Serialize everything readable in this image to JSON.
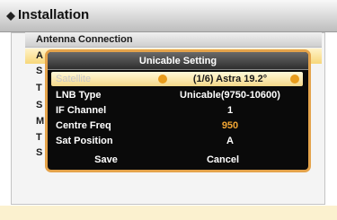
{
  "header": {
    "title": "Installation"
  },
  "menu": {
    "items": [
      {
        "label": "Antenna Connection"
      },
      {
        "label": "A"
      },
      {
        "label": "S"
      },
      {
        "label": "T"
      },
      {
        "label": "S"
      },
      {
        "label": "M"
      },
      {
        "label": "T"
      },
      {
        "label": "S"
      }
    ]
  },
  "dialog": {
    "title": "Unicable Setting",
    "rows": [
      {
        "label": "Satellite",
        "value": "(1/6) Astra 19.2°"
      },
      {
        "label": "LNB Type",
        "value": "Unicable(9750-10600)"
      },
      {
        "label": "IF Channel",
        "value": "1"
      },
      {
        "label": "Centre Freq",
        "value": "950"
      },
      {
        "label": "Sat Position",
        "value": "A"
      }
    ],
    "buttons": {
      "save": "Save",
      "cancel": "Cancel"
    }
  },
  "colors": {
    "dialog_border": "#e4a34b",
    "highlight": "#f5d889",
    "value_accent": "#f2a633"
  }
}
